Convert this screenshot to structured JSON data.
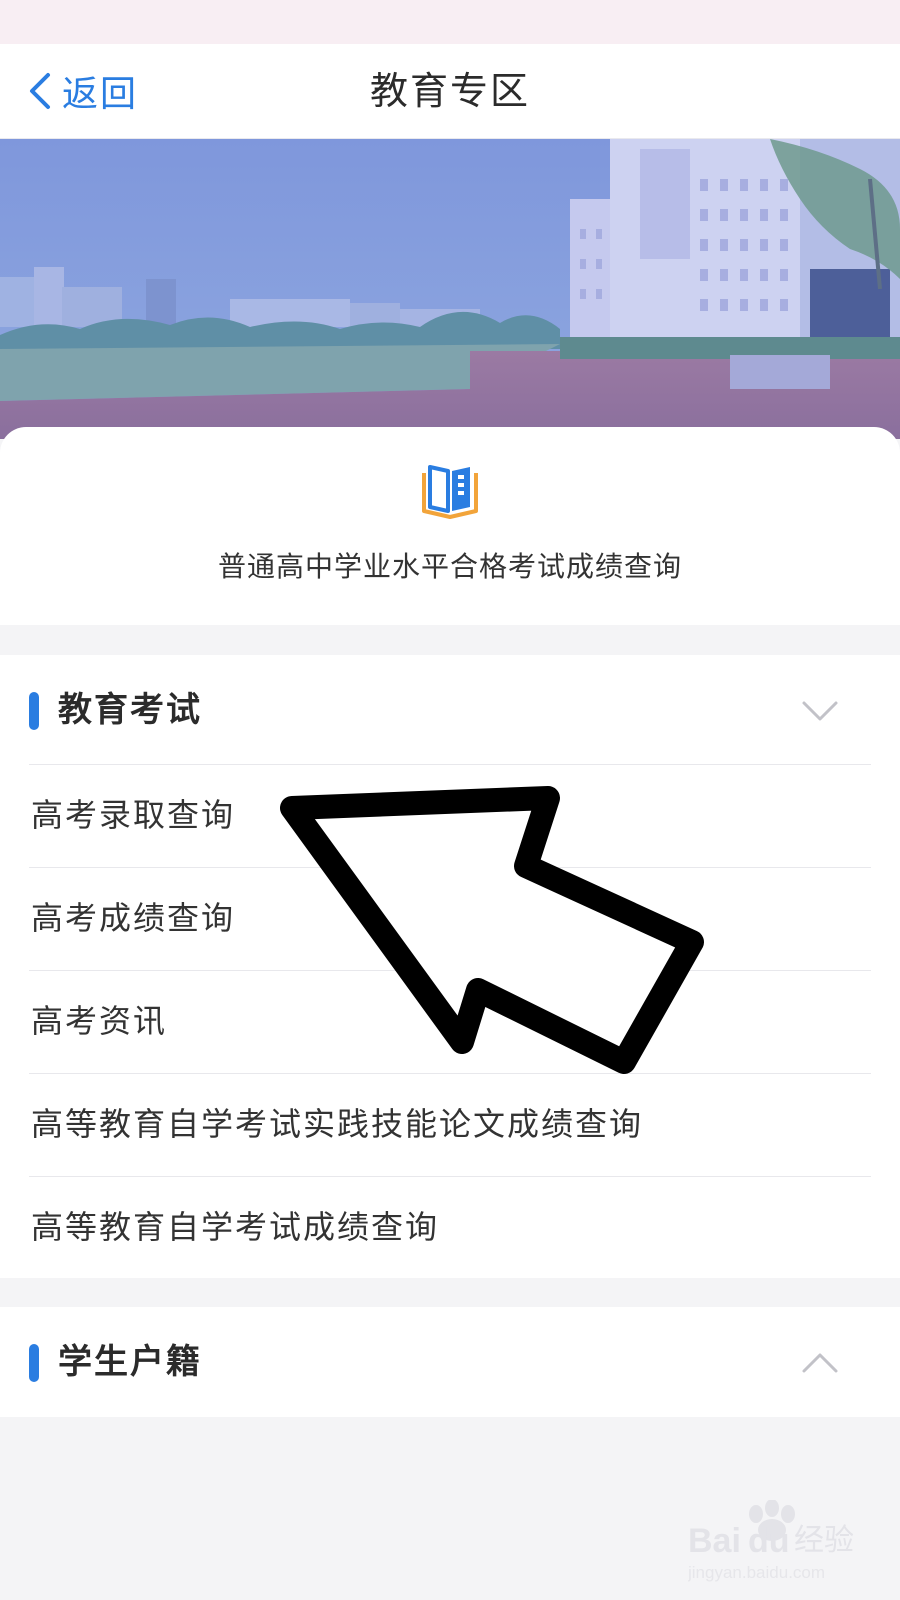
{
  "nav": {
    "back_label": "返回",
    "title": "教育专区"
  },
  "feature": {
    "icon": "book-icon",
    "label": "普通高中学业水平合格考试成绩查询"
  },
  "sections": {
    "exam": {
      "title": "教育考试",
      "expanded": true,
      "items": [
        {
          "label": "高考录取查询"
        },
        {
          "label": "高考成绩查询"
        },
        {
          "label": "高考资讯"
        },
        {
          "label": "高等教育自学考试实践技能论文成绩查询"
        },
        {
          "label": "高等教育自学考试成绩查询"
        }
      ]
    },
    "hukou": {
      "title": "学生户籍",
      "expanded": false
    }
  },
  "colors": {
    "accent": "#2a7de1",
    "background": "#f4f4f6"
  },
  "watermark": {
    "brand_a": "Bai",
    "brand_b": "du",
    "brand_cn": "经验",
    "url": "jingyan.baidu.com"
  }
}
